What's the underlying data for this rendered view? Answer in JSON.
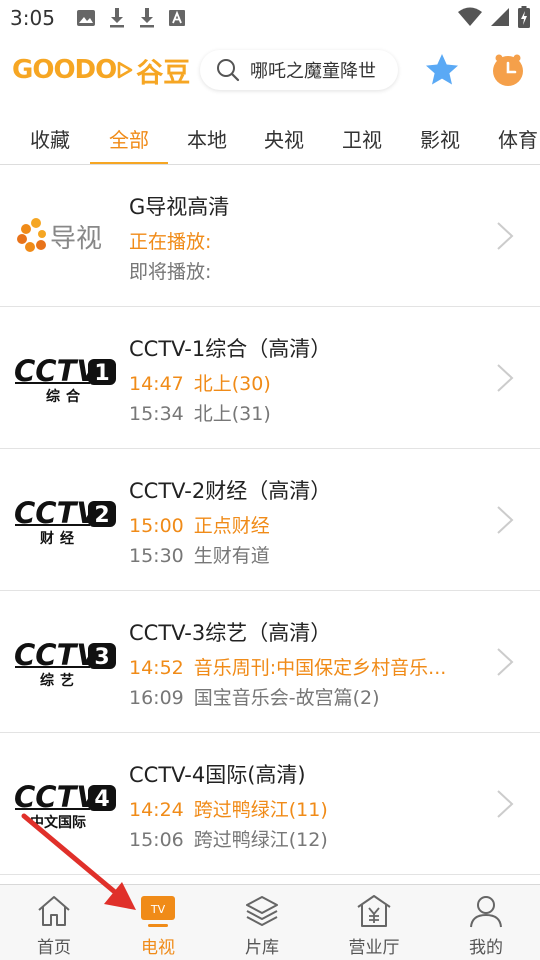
{
  "status_bar": {
    "time": "3:05",
    "left_icons": [
      "image-icon",
      "download-icon",
      "download-icon",
      "font-a-icon"
    ],
    "right_icons": [
      "wifi-icon",
      "signal-icon",
      "battery-charging-icon"
    ]
  },
  "header": {
    "logo_latin": "GOODO",
    "logo_cn": "谷豆",
    "search_text": "哪吒之魔童降世",
    "search_icon": "search-icon",
    "fav_icon": "star-icon",
    "clock_icon": "alarm-clock-icon"
  },
  "tabs": [
    "收藏",
    "全部",
    "本地",
    "央视",
    "卫视",
    "影视",
    "体育"
  ],
  "active_tab": "全部",
  "channels": [
    {
      "name": "G导视高清",
      "logo_text": "导视",
      "now_time": "",
      "now_title": "正在播放:",
      "next_time": "",
      "next_title": "即将播放:"
    },
    {
      "name": "CCTV-1综合（高清）",
      "logo_text": "CCTV",
      "logo_num": "1",
      "logo_sub": "综合",
      "now_time": "14:47",
      "now_title": "北上(30)",
      "next_time": "15:34",
      "next_title": "北上(31)"
    },
    {
      "name": "CCTV-2财经（高清）",
      "logo_text": "CCTV",
      "logo_num": "2",
      "logo_sub": "财经",
      "now_time": "15:00",
      "now_title": "正点财经",
      "next_time": "15:30",
      "next_title": "生财有道"
    },
    {
      "name": "CCTV-3综艺（高清）",
      "logo_text": "CCTV",
      "logo_num": "3",
      "logo_sub": "综艺",
      "now_time": "14:52",
      "now_title": "音乐周刊:中国保定乡村音乐...",
      "next_time": "16:09",
      "next_title": "国宝音乐会-故宫篇(2)"
    },
    {
      "name": "CCTV-4国际(高清)",
      "logo_text": "CCTV",
      "logo_num": "4",
      "logo_sub": "中文国际",
      "now_time": "14:24",
      "now_title": "跨过鸭绿江(11)",
      "next_time": "15:06",
      "next_title": "跨过鸭绿江(12)"
    }
  ],
  "bottom_nav": [
    {
      "label": "首页",
      "icon": "home-icon"
    },
    {
      "label": "电视",
      "icon": "tv-icon",
      "badge": "TV"
    },
    {
      "label": "片库",
      "icon": "layers-icon"
    },
    {
      "label": "营业厅",
      "icon": "store-icon"
    },
    {
      "label": "我的",
      "icon": "user-icon"
    }
  ],
  "active_nav": "电视",
  "colors": {
    "accent": "#f08b18",
    "logo": "#f6a623",
    "annotation_arrow": "#e0302a"
  }
}
